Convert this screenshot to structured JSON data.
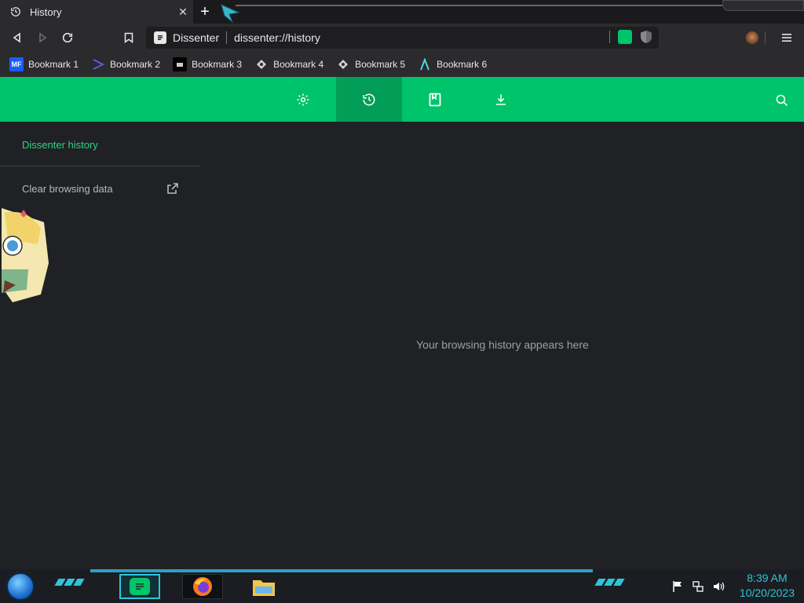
{
  "tab": {
    "title": "History",
    "close": "✕",
    "new_tab": "+"
  },
  "omnibox": {
    "site_name": "Dissenter",
    "url": "dissenter://history"
  },
  "bookmarks": [
    {
      "label": "Bookmark 1",
      "icon": "mediafire-icon",
      "color": "#1a5cff"
    },
    {
      "label": "Bookmark 2",
      "icon": "chevron-bookmark-icon",
      "color": "#3b3bb5"
    },
    {
      "label": "Bookmark 3",
      "icon": "terminal-icon",
      "color": "#000000"
    },
    {
      "label": "Bookmark 4",
      "icon": "dragon-icon",
      "color": "#2b2b2e"
    },
    {
      "label": "Bookmark 5",
      "icon": "dragon-icon",
      "color": "#2b2b2e"
    },
    {
      "label": "Bookmark 6",
      "icon": "lambda-icon",
      "color": "#2b2b2e"
    }
  ],
  "header": {
    "accent": "#00c46a",
    "active_tab": "history"
  },
  "sidebar": {
    "title": "Dissenter history",
    "clear_label": "Clear browsing data"
  },
  "main": {
    "empty_message": "Your browsing history appears here"
  },
  "taskbar": {
    "time": "8:39 AM",
    "date": "10/20/2023"
  }
}
